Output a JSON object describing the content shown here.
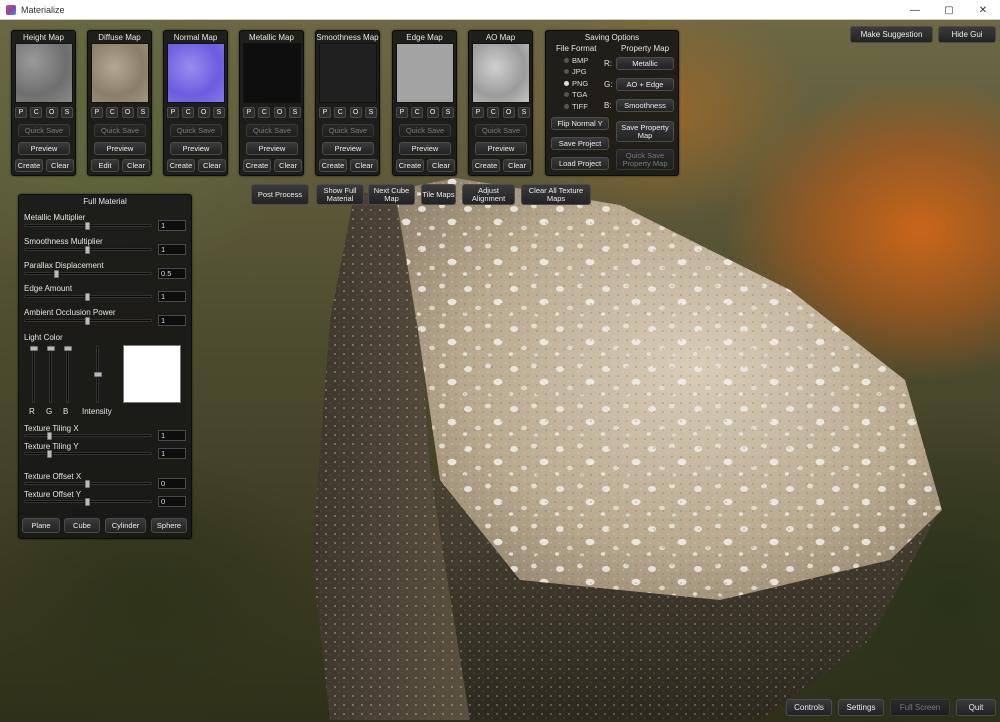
{
  "window": {
    "title": "Materialize",
    "minimize": "—",
    "maximize": "▢",
    "close": "✕"
  },
  "top_right": {
    "suggest": "Make Suggestion",
    "hide_gui": "Hide Gui"
  },
  "maps": [
    {
      "title": "Height Map",
      "quick_save": "Quick Save",
      "preview": "Preview",
      "left": "Create",
      "right": "Clear"
    },
    {
      "title": "Diffuse Map",
      "quick_save": "Quick Save",
      "preview": "Preview",
      "left": "Edit",
      "right": "Clear"
    },
    {
      "title": "Normal Map",
      "quick_save": "Quick Save",
      "preview": "Preview",
      "left": "Create",
      "right": "Clear"
    },
    {
      "title": "Metallic Map",
      "quick_save": "Quick Save",
      "preview": "Preview",
      "left": "Create",
      "right": "Clear"
    },
    {
      "title": "Smoothness Map",
      "quick_save": "Quick Save",
      "preview": "Preview",
      "left": "Create",
      "right": "Clear"
    },
    {
      "title": "Edge Map",
      "quick_save": "Quick Save",
      "preview": "Preview",
      "left": "Create",
      "right": "Clear"
    },
    {
      "title": "AO Map",
      "quick_save": "Quick Save",
      "preview": "Preview",
      "left": "Create",
      "right": "Clear"
    }
  ],
  "pcos": [
    "P",
    "C",
    "O",
    "S"
  ],
  "saving": {
    "title": "Saving Options",
    "file_format": "File Format",
    "formats": [
      "BMP",
      "JPG",
      "PNG",
      "TGA",
      "TIFF"
    ],
    "selected": "PNG",
    "property_map": "Property Map",
    "channels": [
      {
        "ch": "R:",
        "val": "Metallic"
      },
      {
        "ch": "G:",
        "val": "AO + Edge"
      },
      {
        "ch": "B:",
        "val": "Smoothness"
      }
    ],
    "flip_normal": "Flip Normal Y",
    "save_project": "Save Project",
    "load_project": "Load Project",
    "save_property": "Save Property Map",
    "quick_save_property": "Quick Save Property Map"
  },
  "toolbar": {
    "post_process": "Post Process",
    "show_full": "Show Full Material",
    "next_cube": "Next Cube Map",
    "tile_maps": "Tile Maps",
    "adjust_alignment": "Adjust Alignment",
    "clear_all": "Clear All Texture Maps"
  },
  "full_material": {
    "title": "Full Material",
    "sliders": [
      {
        "label": "Metallic Multiplier",
        "value": "1",
        "pos": 0.5
      },
      {
        "label": "Smoothness Multiplier",
        "value": "1",
        "pos": 0.5
      },
      {
        "label": "Parallax Displacement",
        "value": "0.5",
        "pos": 0.25
      },
      {
        "label": "Edge Amount",
        "value": "1",
        "pos": 0.5
      },
      {
        "label": "Ambient Occlusion Power",
        "value": "1",
        "pos": 0.5
      }
    ],
    "light_color": "Light Color",
    "rgb": {
      "r": "R",
      "g": "G",
      "b": "B",
      "intensity": "Intensity"
    },
    "light_levels": {
      "r": 1,
      "g": 1,
      "b": 1,
      "intensity": 0.5
    },
    "swatch_color": "#ffffff",
    "tiling": [
      {
        "label": "Texture Tiling X",
        "value": "1",
        "pos": 0.2
      },
      {
        "label": "Texture Tiling Y",
        "value": "1",
        "pos": 0.2
      }
    ],
    "offset": [
      {
        "label": "Texture Offset X",
        "value": "0",
        "pos": 0.5
      },
      {
        "label": "Texture Offset Y",
        "value": "0",
        "pos": 0.5
      }
    ],
    "shapes": [
      "Plane",
      "Cube",
      "Cylinder",
      "Sphere"
    ]
  },
  "bottom": {
    "controls": "Controls",
    "settings": "Settings",
    "full_screen": "Full Screen",
    "quit": "Quit"
  }
}
